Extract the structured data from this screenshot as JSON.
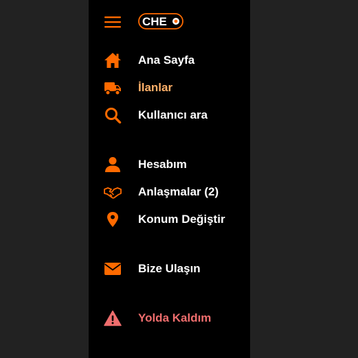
{
  "brand": {
    "logo_text": "CHE",
    "accent_color": "#ff6a00"
  },
  "colors": {
    "icon": "#ff6a00",
    "active_label": "#ffb069",
    "warning_label": "#ee6d6d",
    "default_label": "#ffffff"
  },
  "nav": {
    "home": {
      "label": "Ana Sayfa",
      "icon": "home-icon"
    },
    "listings": {
      "label": "İlanlar",
      "icon": "truck-icon",
      "active": true
    },
    "search_user": {
      "label": "Kullanıcı ara",
      "icon": "search-icon"
    },
    "account": {
      "label": "Hesabım",
      "icon": "user-icon"
    },
    "deals": {
      "label": "Anlaşmalar (2)",
      "icon": "handshake-icon"
    },
    "location": {
      "label": "Konum Değiştir",
      "icon": "map-pin-icon"
    },
    "contact": {
      "label": "Bize Ulaşın",
      "icon": "envelope-icon"
    },
    "stuck": {
      "label": "Yolda Kaldım",
      "icon": "warning-icon"
    }
  }
}
